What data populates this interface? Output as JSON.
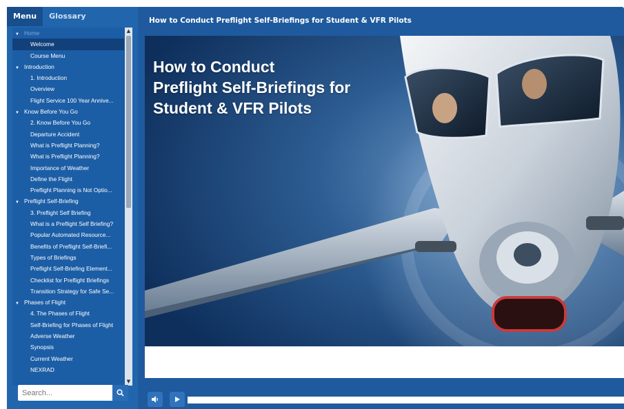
{
  "sidebar": {
    "tabs": [
      {
        "label": "Menu",
        "active": true
      },
      {
        "label": "Glossary",
        "active": false
      }
    ],
    "items": [
      {
        "label": "Home",
        "type": "section",
        "dim": true
      },
      {
        "label": "Welcome",
        "type": "item",
        "selected": true
      },
      {
        "label": "Course Menu",
        "type": "item"
      },
      {
        "label": "Introduction",
        "type": "section"
      },
      {
        "label": "1. Introduction",
        "type": "item"
      },
      {
        "label": "Overview",
        "type": "item"
      },
      {
        "label": "Flight Service 100 Year Annive...",
        "type": "item"
      },
      {
        "label": "Know Before You Go",
        "type": "section"
      },
      {
        "label": "2. Know Before You Go",
        "type": "item"
      },
      {
        "label": "Departure Accident",
        "type": "item"
      },
      {
        "label": "What is Preflight Planning?",
        "type": "item"
      },
      {
        "label": "What is Preflight Planning?",
        "type": "item"
      },
      {
        "label": "Importance of Weather",
        "type": "item"
      },
      {
        "label": "Define the Flight",
        "type": "item"
      },
      {
        "label": "Preflight Planning is Not Optio...",
        "type": "item"
      },
      {
        "label": "Preflight Self-Briefing",
        "type": "section"
      },
      {
        "label": "3. Preflight Self Briefing",
        "type": "item"
      },
      {
        "label": "What is a Preflight Self Briefing?",
        "type": "item"
      },
      {
        "label": "Popular Automated Resource...",
        "type": "item"
      },
      {
        "label": "Benefits of Preflight Self-Briefi...",
        "type": "item"
      },
      {
        "label": "Types of Briefings",
        "type": "item"
      },
      {
        "label": "Preflight Self-Briefing Element...",
        "type": "item"
      },
      {
        "label": "Checklist for Preflight Briefings",
        "type": "item"
      },
      {
        "label": "Transition Strategy for Safe Se...",
        "type": "item"
      },
      {
        "label": "Phases of Flight",
        "type": "section"
      },
      {
        "label": "4. The Phases of Flight",
        "type": "item"
      },
      {
        "label": "Self-Briefing for Phases of Flight",
        "type": "item"
      },
      {
        "label": "Adverse Weather",
        "type": "item"
      },
      {
        "label": "Synopsis",
        "type": "item"
      },
      {
        "label": "Current Weather",
        "type": "item"
      },
      {
        "label": "NEXRAD",
        "type": "item"
      }
    ],
    "search_placeholder": "Search..."
  },
  "header": {
    "title": "How to Conduct Preflight Self-Briefings for Student & VFR Pilots"
  },
  "slide": {
    "title_lines": [
      "How to Conduct",
      "Preflight Self-Briefings for",
      "Student & VFR Pilots"
    ]
  },
  "player": {
    "progress": 0.0
  },
  "icons": {
    "search": "search-icon",
    "volume": "volume-icon",
    "play": "play-icon",
    "scroll_up": "chevron-up-icon",
    "scroll_down": "chevron-down-icon",
    "expand": "triangle-down-icon"
  },
  "colors": {
    "frame": "#1f5a9e",
    "sidebar": "#2165ad",
    "selected": "#12407a",
    "button": "#2f73bd"
  }
}
